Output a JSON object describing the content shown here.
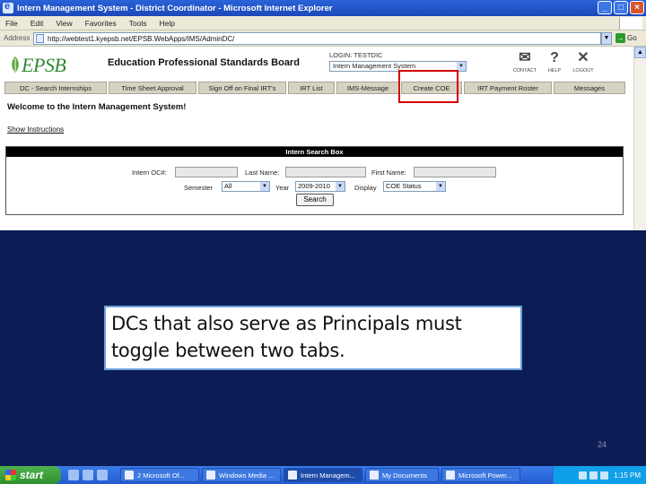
{
  "window": {
    "title": "Intern Management System - District Coordinator - Microsoft Internet Explorer"
  },
  "menu": [
    "File",
    "Edit",
    "View",
    "Favorites",
    "Tools",
    "Help"
  ],
  "address": {
    "label": "Address",
    "url": "http://webtest1.kyepsb.net/EPSB.WebApps/IMS/AdminDC/",
    "go_label": "Go"
  },
  "header": {
    "logo_text": "EPSB",
    "board_title": "Education Professional Standards Board",
    "login_label": "LOGIN: TESTDIC",
    "system_select": "Intern Management System",
    "icons": [
      {
        "name": "contact-icon",
        "label": "CONTACT",
        "glyph": "✉"
      },
      {
        "name": "help-icon",
        "label": "HELP",
        "glyph": "?"
      },
      {
        "name": "logout-icon",
        "label": "LOGOUT",
        "glyph": "✕"
      }
    ]
  },
  "nav_tabs": [
    "DC - Search Internships",
    "Time Sheet Approval",
    "Sign Off on Final IRT's",
    "IRT List",
    "IMS-Message",
    "Create COE",
    "IRT Payment Roster",
    "Messages"
  ],
  "main": {
    "welcome": "Welcome to the Intern Management System!",
    "show_instructions": "Show Instructions"
  },
  "search_box": {
    "title": "Intern Search Box",
    "intern_ocn_label": "Intern OC#:",
    "last_name_label": "Last Name:",
    "first_name_label": "First Name:",
    "semester_label": "Semester",
    "semester_value": "All",
    "year_label": "Year",
    "year_value": "2009-2010",
    "display_label": "Display",
    "display_value": "COE Status",
    "search_button": "Search"
  },
  "callout": {
    "text": "DCs that also serve as Principals must toggle between two tabs."
  },
  "slide_number": "24",
  "taskbar": {
    "start_label": "start",
    "tasks": [
      {
        "label": "2 Microsoft Of...",
        "active": false
      },
      {
        "label": "Windows Media ...",
        "active": false
      },
      {
        "label": "Intern Managem...",
        "active": true
      },
      {
        "label": "My Documents",
        "active": false
      },
      {
        "label": "Microsoft Power...",
        "active": false
      }
    ],
    "clock": "1:15 PM"
  },
  "colors": {
    "slide_background": "#0c1d55",
    "highlight": "#d40000",
    "callout_border": "#6fa1d8",
    "logo_green": "#2f8a2f"
  }
}
